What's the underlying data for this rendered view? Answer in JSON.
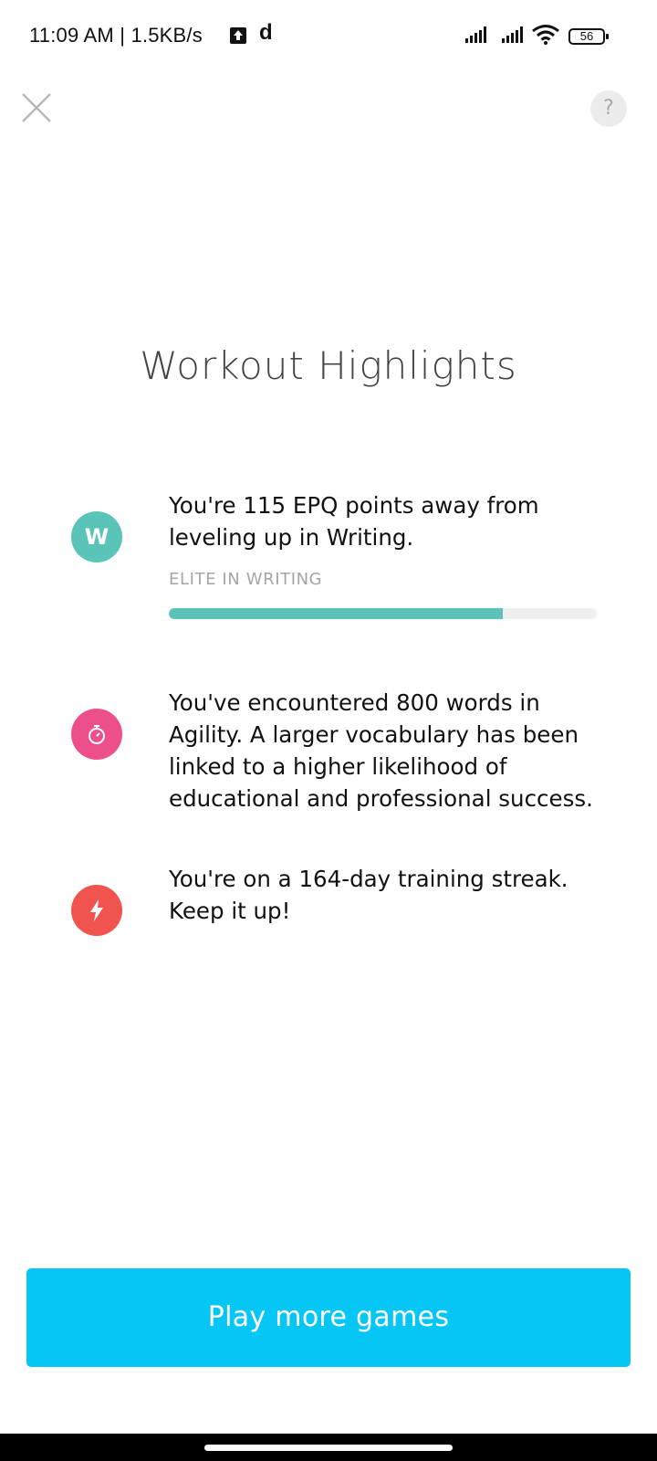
{
  "status_bar": {
    "time_and_speed": "11:09 AM | 1.5KB/s",
    "app_glyph": "d",
    "battery": "56"
  },
  "header": {
    "close_icon": "close-icon",
    "help_label": "?"
  },
  "title": "Workout Highlights",
  "highlights": [
    {
      "icon": "letter-w-badge",
      "icon_text": "W",
      "icon_color": "#5bc4b9",
      "text": "You're 115 EPQ points away from leveling up in Writing.",
      "sublabel": "ELITE IN WRITING",
      "progress": 0.78
    },
    {
      "icon": "stopwatch-icon",
      "icon_color": "#ec4f8a",
      "text": "You've encountered 800 words in Agility. A larger vocabulary has been linked to a higher likelihood of educational and professional success."
    },
    {
      "icon": "lightning-icon",
      "icon_color": "#f1534f",
      "text": "You're on a 164-day training streak. Keep it up!"
    }
  ],
  "primary_button": {
    "label": "Play more games",
    "color": "#06c6f5"
  }
}
